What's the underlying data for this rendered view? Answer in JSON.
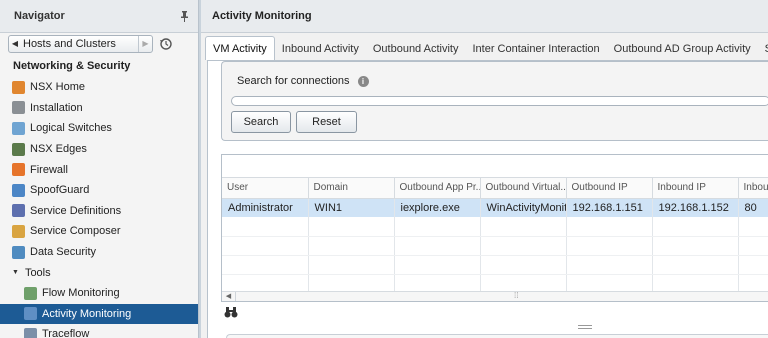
{
  "navigator": {
    "title": "Navigator",
    "breadcrumb": "Hosts and Clusters",
    "section": "Networking & Security",
    "items": [
      {
        "label": "NSX Home",
        "icon": "nsx-home-icon",
        "color": "#e0862f"
      },
      {
        "label": "Installation",
        "icon": "gear-icon",
        "color": "#8a8f94"
      },
      {
        "label": "Logical Switches",
        "icon": "logical-switch-icon",
        "color": "#6fa4d2"
      },
      {
        "label": "NSX Edges",
        "icon": "edge-icon",
        "color": "#5b7a4b"
      },
      {
        "label": "Firewall",
        "icon": "firewall-icon",
        "color": "#e6742b"
      },
      {
        "label": "SpoofGuard",
        "icon": "spoofguard-icon",
        "color": "#4c86c6"
      },
      {
        "label": "Service Definitions",
        "icon": "service-definitions-icon",
        "color": "#5d6fae"
      },
      {
        "label": "Service Composer",
        "icon": "service-composer-icon",
        "color": "#d9a441"
      },
      {
        "label": "Data Security",
        "icon": "data-security-icon",
        "color": "#4f8bc0"
      }
    ],
    "tools_group": "Tools",
    "tools": [
      {
        "label": "Flow Monitoring",
        "icon": "flow-monitoring-icon",
        "color": "#6fa06a"
      },
      {
        "label": "Activity Monitoring",
        "icon": "activity-monitoring-icon",
        "color": "#5f8fc4",
        "selected": true
      },
      {
        "label": "Traceflow",
        "icon": "traceflow-icon",
        "color": "#7b8fa8"
      }
    ]
  },
  "main": {
    "title": "Activity Monitoring",
    "tabs": [
      {
        "label": "VM Activity",
        "active": true
      },
      {
        "label": "Inbound Activity"
      },
      {
        "label": "Outbound Activity"
      },
      {
        "label": "Inter Container Interaction"
      },
      {
        "label": "Outbound AD Group Activity"
      },
      {
        "label": "Settin"
      }
    ],
    "search": {
      "label": "Search for connections",
      "value": "",
      "search_button": "Search",
      "reset_button": "Reset"
    },
    "grid": {
      "columns": [
        "User",
        "Domain",
        "Outbound App Pr...",
        "Outbound Virtual...",
        "Outbound IP",
        "Inbound IP",
        "Inboun"
      ],
      "rows": [
        [
          "Administrator",
          "WIN1",
          "iexplore.exe",
          "WinActivityMonito",
          "192.168.1.151",
          "192.168.1.152",
          "80"
        ]
      ]
    }
  }
}
